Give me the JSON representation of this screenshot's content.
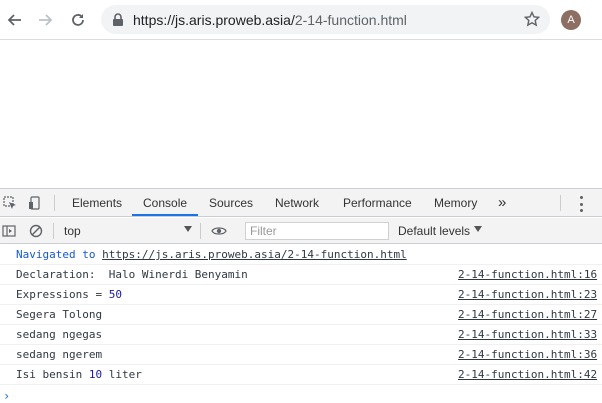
{
  "browser": {
    "url_host": "https://js.aris.proweb.asia/",
    "url_path": "2-14-function.html",
    "avatar_letter": "A",
    "icons": [
      "back-icon",
      "forward-icon",
      "reload-icon",
      "lock-icon",
      "star-icon"
    ]
  },
  "devtools": {
    "tabs": [
      {
        "label": "Elements"
      },
      {
        "label": "Console",
        "active": true
      },
      {
        "label": "Sources"
      },
      {
        "label": "Network"
      },
      {
        "label": "Performance"
      },
      {
        "label": "Memory"
      }
    ],
    "more_tabs": "»",
    "context": "top",
    "filter_placeholder": "Filter",
    "levels": "Default levels",
    "accent_color": "#1a73e8"
  },
  "console": {
    "navigated_prefix": "Navigated to ",
    "navigated_url": "https://js.aris.proweb.asia/2-14-function.html",
    "rows": [
      {
        "pre": "Declaration:  Halo Winerdi Benyamin",
        "num": "",
        "post": "",
        "src": "2-14-function.html:16"
      },
      {
        "pre": "Expressions = ",
        "num": "50",
        "post": "",
        "src": "2-14-function.html:23"
      },
      {
        "pre": "Segera Tolong",
        "num": "",
        "post": "",
        "src": "2-14-function.html:27"
      },
      {
        "pre": "sedang ngegas",
        "num": "",
        "post": "",
        "src": "2-14-function.html:33"
      },
      {
        "pre": "sedang ngerem",
        "num": "",
        "post": "",
        "src": "2-14-function.html:36"
      },
      {
        "pre": "Isi bensin ",
        "num": "10",
        "post": " liter",
        "src": "2-14-function.html:42"
      }
    ],
    "prompt": "›"
  }
}
